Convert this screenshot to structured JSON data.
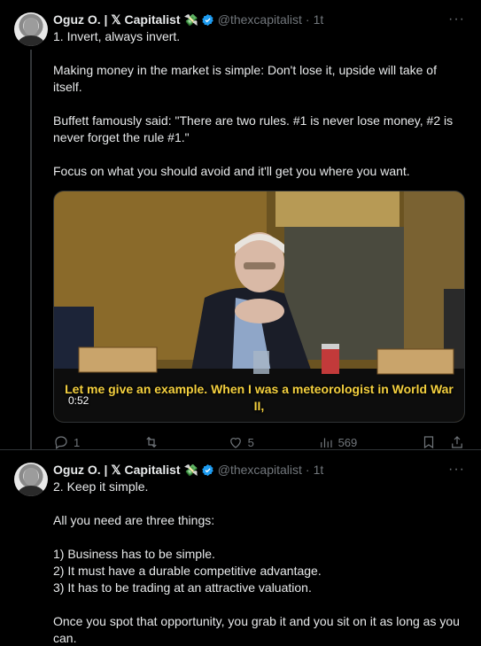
{
  "tweets": [
    {
      "author": {
        "name": "Oguz O. | 𝕏 Capitalist",
        "badge_emoji": "💸",
        "handle": "@thexcapitalist",
        "time": "1t"
      },
      "text": {
        "l1": "1. Invert, always invert.",
        "l2": "Making money in the market is simple: Don't lose it, upside will take of itself.",
        "l3": "Buffett famously said: \"There are two rules. #1 is never lose money, #2 is never forget the rule #1.\"",
        "l4": "Focus on what you should avoid and it'll get you where you want."
      },
      "video": {
        "caption": "Let me give an example. When I was a meteorologist in World War II,",
        "timestamp": "0:52"
      },
      "stats": {
        "replies": "1",
        "retweets": "",
        "likes": "5",
        "views": "569"
      }
    },
    {
      "author": {
        "name": "Oguz O. | 𝕏 Capitalist",
        "badge_emoji": "💸",
        "handle": "@thexcapitalist",
        "time": "1t"
      },
      "text": {
        "l1": "2. Keep it simple.",
        "l2": "All you need are three things:",
        "l3a": "1) Business has to be simple.",
        "l3b": "2) It must have a durable competitive advantage.",
        "l3c": "3) It has to be trading at an attractive valuation.",
        "l4": "Once you spot that opportunity, you grab it and you sit on it as long as you can."
      }
    }
  ],
  "icons": {
    "more": "more-icon",
    "verified": "verified-badge-icon",
    "reply": "reply-icon",
    "retweet": "retweet-icon",
    "like": "like-icon",
    "views": "views-icon",
    "bookmark": "bookmark-icon",
    "share": "share-icon"
  },
  "colors": {
    "accent": "#1d9bf0",
    "muted": "#71767b",
    "caption": "#f4d03f",
    "background": "#000000"
  },
  "more_glyph": "···"
}
